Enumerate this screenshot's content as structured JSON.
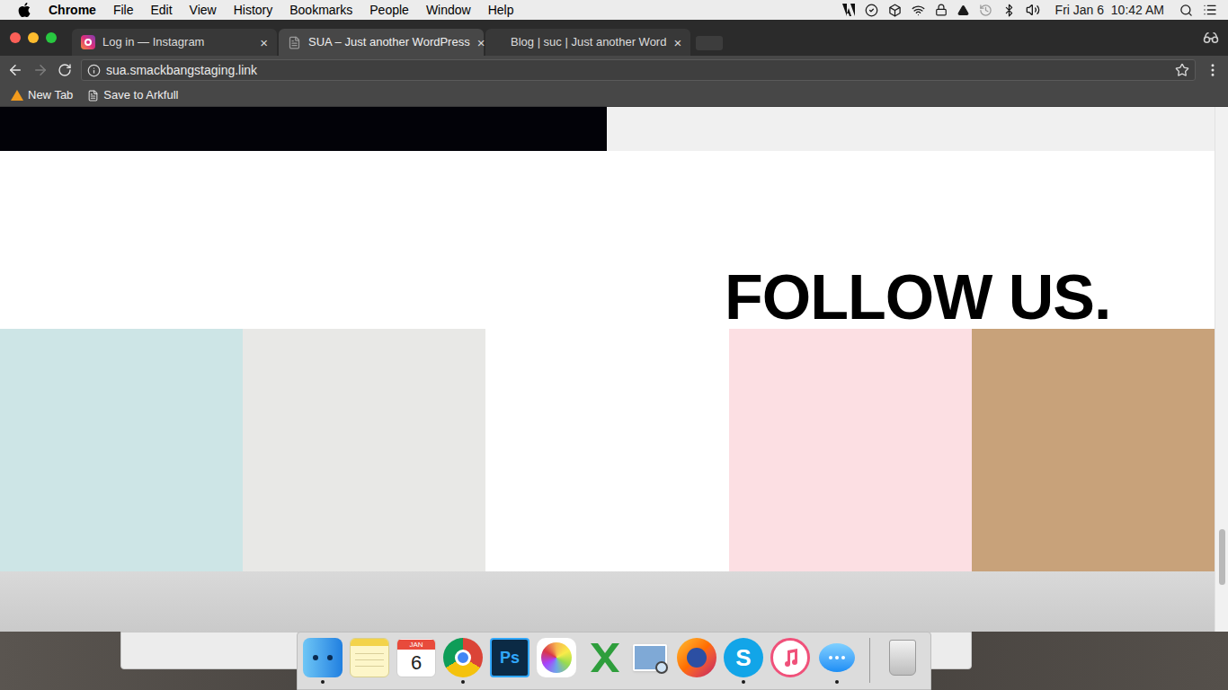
{
  "menu_bar": {
    "app": "Chrome",
    "items": [
      "File",
      "Edit",
      "View",
      "History",
      "Bookmarks",
      "People",
      "Window",
      "Help"
    ],
    "clock": "Fri Jan 6  10:42 AM"
  },
  "tabs": [
    {
      "label": "Log in — Instagram",
      "selected": false,
      "favicon": "instagram",
      "close": "×"
    },
    {
      "label": "SUA – Just another WordPress",
      "selected": true,
      "favicon": "page",
      "close": "×"
    },
    {
      "label": "Blog | suc | Just another Word",
      "selected": false,
      "favicon": "none",
      "close": "×"
    }
  ],
  "address_bar": {
    "url": "sua.smackbangstaging.link"
  },
  "bookmarks": [
    {
      "label": "New Tab",
      "kind": "app"
    },
    {
      "label": "Save to Arkfull",
      "kind": "page"
    }
  ],
  "page": {
    "heading": "FOLLOW US.",
    "tiles": [
      {
        "color": "#cde5e6"
      },
      {
        "color": "#e8e8e6"
      },
      {
        "color": "#ffffff"
      },
      {
        "color": "#fcdfe3"
      },
      {
        "color": "#c8a27a"
      }
    ],
    "scroll_position": 0.87
  },
  "dock": [
    {
      "kind": "finder",
      "glyph": "",
      "running": true
    },
    {
      "kind": "notes",
      "glyph": "",
      "running": false
    },
    {
      "kind": "calendar",
      "glyph": "6",
      "month": "JAN",
      "running": false
    },
    {
      "kind": "chrome",
      "glyph": "",
      "running": true
    },
    {
      "kind": "photoshop",
      "glyph": "Ps",
      "running": false
    },
    {
      "kind": "photos",
      "glyph": "",
      "running": false
    },
    {
      "kind": "x-app",
      "glyph": "",
      "running": false
    },
    {
      "kind": "preview",
      "glyph": "",
      "running": false
    },
    {
      "kind": "firefox",
      "glyph": "",
      "running": false
    },
    {
      "kind": "skype",
      "glyph": "S",
      "running": true
    },
    {
      "kind": "itunes",
      "glyph": "",
      "running": false
    },
    {
      "kind": "messages",
      "glyph": "",
      "running": true
    },
    {
      "kind": "trash",
      "glyph": "",
      "running": false
    }
  ]
}
